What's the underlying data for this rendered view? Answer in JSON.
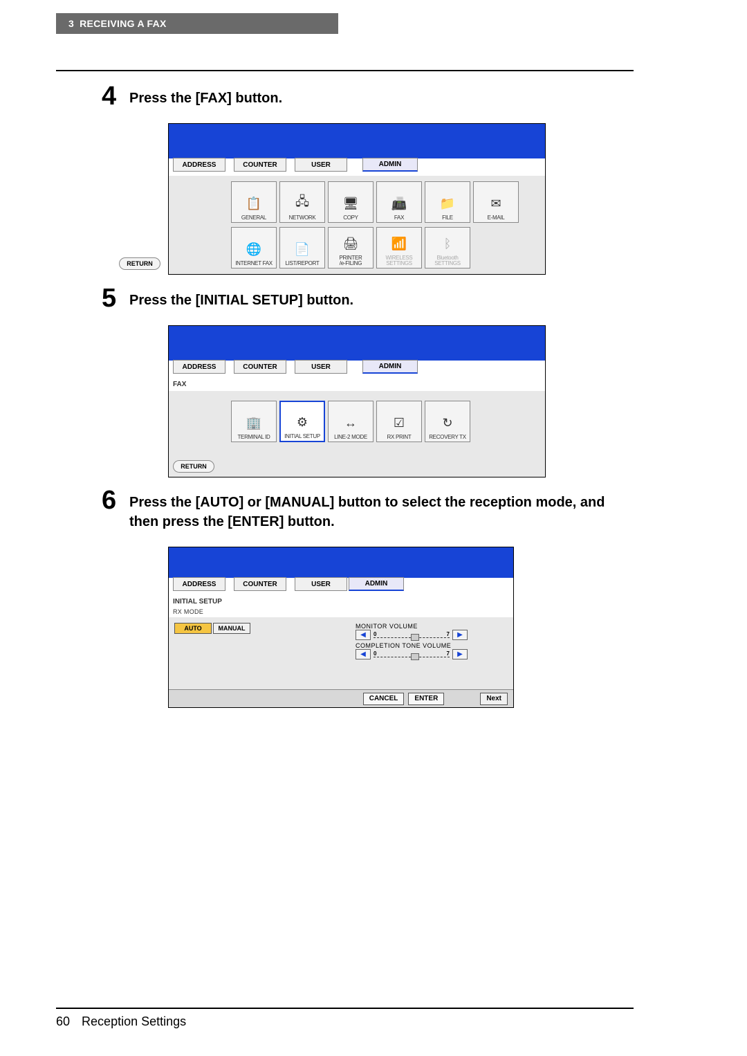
{
  "header": {
    "chapter": "3",
    "title": "RECEIVING A FAX"
  },
  "step4": {
    "num": "4",
    "text": "Press the [FAX] button.",
    "tabs": {
      "address": "ADDRESS",
      "counter": "COUNTER",
      "user": "USER",
      "admin": "ADMIN"
    },
    "icons_row1": [
      {
        "label": "GENERAL"
      },
      {
        "label": "NETWORK"
      },
      {
        "label": "COPY"
      },
      {
        "label": "FAX"
      },
      {
        "label": "FILE"
      },
      {
        "label": "E-MAIL"
      }
    ],
    "icons_row2": [
      {
        "label": "INTERNET FAX"
      },
      {
        "label": "LIST/REPORT"
      },
      {
        "label": "PRINTER\n/e-FILING"
      },
      {
        "label": "WIRELESS\nSETTINGS",
        "disabled": true
      },
      {
        "label": "Bluetooth\nSETTINGS",
        "disabled": true
      }
    ],
    "return": "RETURN"
  },
  "step5": {
    "num": "5",
    "text": "Press the [INITIAL SETUP] button.",
    "tabs": {
      "address": "ADDRESS",
      "counter": "COUNTER",
      "user": "USER",
      "admin": "ADMIN"
    },
    "breadcrumb": "FAX",
    "icons": [
      {
        "label": "TERMINAL ID"
      },
      {
        "label": "INITIAL SETUP"
      },
      {
        "label": "LINE-2 MODE"
      },
      {
        "label": "RX PRINT"
      },
      {
        "label": "RECOVERY TX"
      }
    ],
    "return": "RETURN"
  },
  "step6": {
    "num": "6",
    "text": "Press the [AUTO] or [MANUAL] button to select the reception mode, and then press the [ENTER] button.",
    "tabs": {
      "address": "ADDRESS",
      "counter": "COUNTER",
      "user": "USER",
      "admin": "ADMIN"
    },
    "breadcrumb": "INITIAL SETUP",
    "subtitle": "RX MODE",
    "auto": "AUTO",
    "manual": "MANUAL",
    "monitor_label": "MONITOR VOLUME",
    "completion_label": "COMPLETION TONE VOLUME",
    "scale_min": "0",
    "scale_max": "7",
    "cancel": "CANCEL",
    "enter": "ENTER",
    "next": "Next"
  },
  "footer": {
    "page": "60",
    "title": "Reception Settings"
  }
}
